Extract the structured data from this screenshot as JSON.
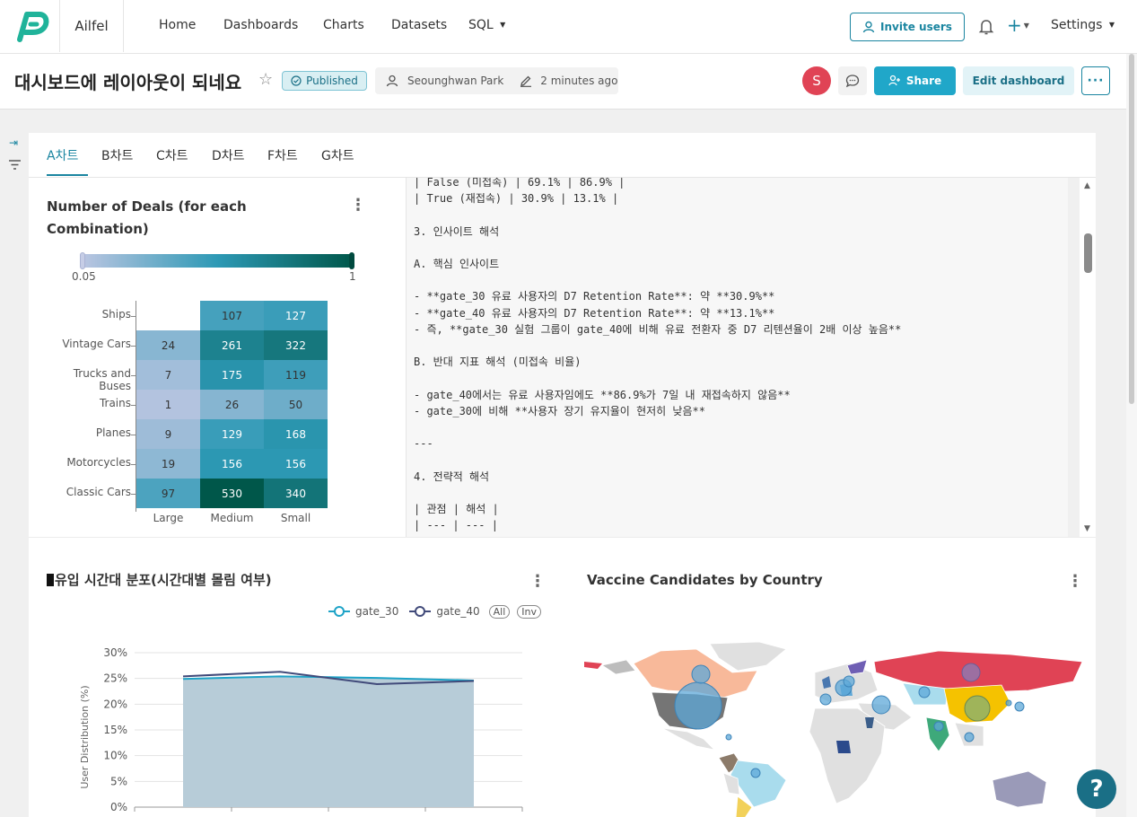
{
  "app": {
    "name": "Ailfel"
  },
  "nav": {
    "items": [
      "Home",
      "Dashboards",
      "Charts",
      "Datasets",
      "SQL"
    ],
    "invite_label": "Invite users",
    "settings_label": "Settings"
  },
  "header": {
    "title": "대시보드에 레이아웃이 되네요",
    "status": "Published",
    "owner": "Seounghwan Park",
    "modified": "2 minutes ago",
    "avatar_initial": "S",
    "share_label": "Share",
    "edit_label": "Edit dashboard"
  },
  "tabs": [
    "A차트",
    "B차트",
    "C차트",
    "D차트",
    "F차트",
    "G차트"
  ],
  "heatmap": {
    "title_line1": "Number of Deals (for each",
    "title_line2": "Combination)",
    "legend_min": "0.05",
    "legend_max": "1"
  },
  "markdown": {
    "text": "| False (미접속) | 69.1% | 86.9% |\n| True (재접속) | 30.9% | 13.1% |\n\n3. 인사이트 해석\n\nA. 핵심 인사이트\n\n- **gate_30 유료 사용자의 D7 Retention Rate**: 약 **30.9%**\n- **gate_40 유료 사용자의 D7 Retention Rate**: 약 **13.1%**\n- 즉, **gate_30 실험 그룹이 gate_40에 비해 유료 전환자 중 D7 리텐션율이 2배 이상 높음**\n\nB. 반대 지표 해석 (미접속 비율)\n\n- gate_40에서는 유료 사용자임에도 **86.9%가 7일 내 재접속하지 않음**\n- gate_30에 비해 **사용자 장기 유지율이 현저히 낮음**\n\n---\n\n4. 전략적 해석\n\n| 관점 | 해석 |\n| --- | --- |"
  },
  "area_chart": {
    "title": "유입 시간대 분포(시간대별 몰림 여부)",
    "legend_all": "All",
    "legend_inv": "Inv"
  },
  "map": {
    "title": "Vaccine Candidates by Country"
  },
  "help_label": "?",
  "chart_data": [
    {
      "type": "heatmap",
      "title": "Number of Deals (for each Combination)",
      "x_categories": [
        "Large",
        "Medium",
        "Small"
      ],
      "y_categories": [
        "Ships",
        "Vintage Cars",
        "Trucks and Buses",
        "Trains",
        "Planes",
        "Motorcycles",
        "Classic Cars"
      ],
      "values": [
        [
          null,
          107,
          127
        ],
        [
          24,
          261,
          322
        ],
        [
          7,
          175,
          119
        ],
        [
          1,
          26,
          50
        ],
        [
          9,
          129,
          168
        ],
        [
          19,
          156,
          156
        ],
        [
          97,
          530,
          340
        ]
      ],
      "color_range": [
        0.05,
        1
      ],
      "colors": [
        "#bcc6e2",
        "#2d99b5",
        "#00574a"
      ]
    },
    {
      "type": "area",
      "title": "유입 시간대 분포(시간대별 몰림 여부)",
      "ylabel": "User Distribution (%)",
      "ylim": [
        0,
        30
      ],
      "yticks": [
        "0%",
        "5%",
        "10%",
        "15%",
        "20%",
        "25%",
        "30%"
      ],
      "series": [
        {
          "name": "gate_30",
          "color": "#1ea3c7",
          "values": [
            24.9,
            25.4,
            25.1,
            24.6
          ]
        },
        {
          "name": "gate_40",
          "color": "#414a7a",
          "values": [
            25.4,
            26.3,
            23.9,
            24.5
          ]
        }
      ],
      "legend": "top-right"
    },
    {
      "type": "map",
      "title": "Vaccine Candidates by Country"
    }
  ]
}
